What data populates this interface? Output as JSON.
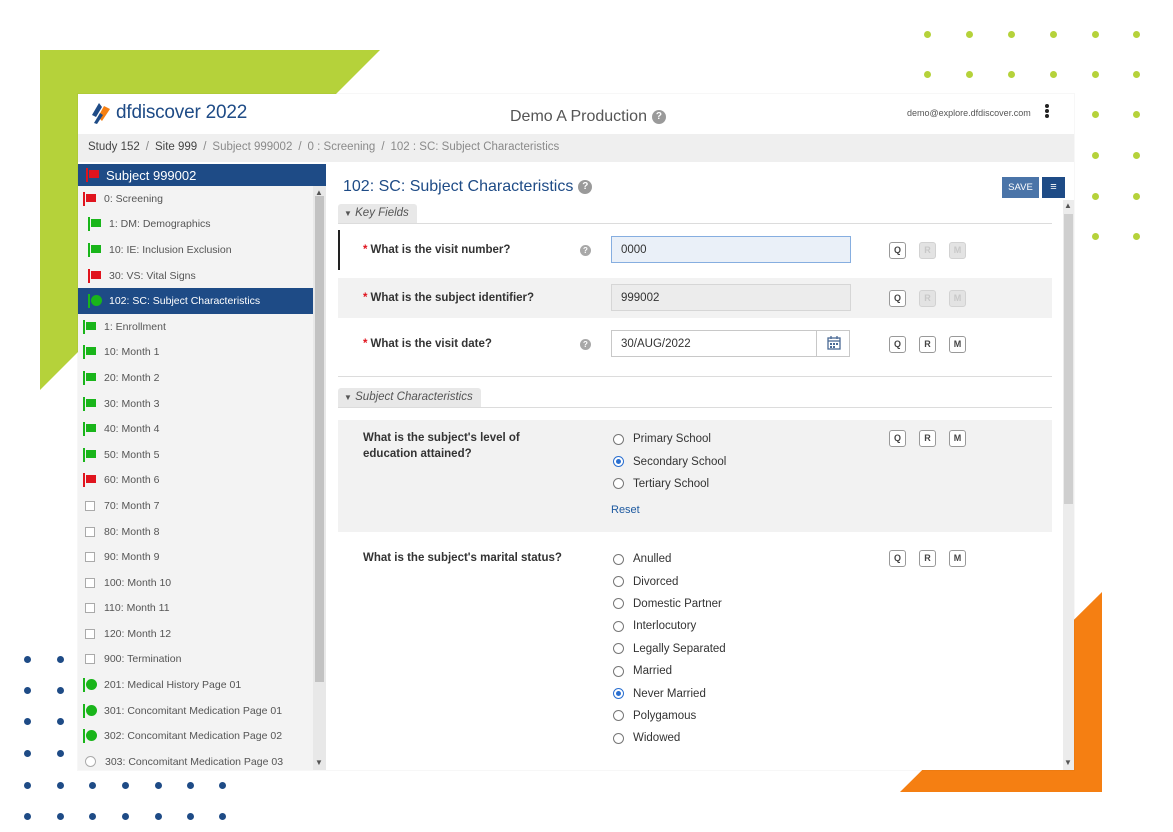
{
  "app": {
    "logo_text": "dfdiscover 2022",
    "title": "Demo A Production",
    "user_email": "demo@explore.dfdiscover.com"
  },
  "breadcrumb": [
    "Study 152",
    "Site 999",
    "Subject 999002",
    "0 : Screening",
    "102 : SC: Subject Characteristics"
  ],
  "sidebar": {
    "header": "Subject 999002",
    "items": [
      {
        "label": "0: Screening",
        "status": "red-flag"
      },
      {
        "label": "1: DM: Demographics",
        "status": "green-flag"
      },
      {
        "label": "10: IE: Inclusion Exclusion",
        "status": "green-flag"
      },
      {
        "label": "30: VS: Vital Signs",
        "status": "red-flag"
      },
      {
        "label": "102: SC: Subject Characteristics",
        "status": "green-circle"
      },
      {
        "label": "1: Enrollment",
        "status": "green-flag"
      },
      {
        "label": "10: Month 1",
        "status": "green-flag"
      },
      {
        "label": "20: Month 2",
        "status": "green-flag"
      },
      {
        "label": "30: Month 3",
        "status": "green-flag"
      },
      {
        "label": "40: Month 4",
        "status": "green-flag"
      },
      {
        "label": "50: Month 5",
        "status": "green-flag"
      },
      {
        "label": "60: Month 6",
        "status": "red-flag"
      },
      {
        "label": "70: Month 7",
        "status": "empty"
      },
      {
        "label": "80: Month 8",
        "status": "empty"
      },
      {
        "label": "90: Month 9",
        "status": "empty"
      },
      {
        "label": "100: Month 10",
        "status": "empty"
      },
      {
        "label": "110: Month 11",
        "status": "empty"
      },
      {
        "label": "120: Month 12",
        "status": "empty"
      },
      {
        "label": "900: Termination",
        "status": "empty"
      },
      {
        "label": "201: Medical History Page 01",
        "status": "green-circle"
      },
      {
        "label": "301: Concomitant Medication Page 01",
        "status": "green-circle"
      },
      {
        "label": "302: Concomitant Medication Page 02",
        "status": "green-circle"
      },
      {
        "label": "303: Concomitant Medication Page 03",
        "status": "empty-circle"
      }
    ]
  },
  "form": {
    "title": "102: SC: Subject Characteristics",
    "save_label": "SAVE",
    "sections": {
      "key_fields": "Key Fields",
      "subject_characteristics": "Subject Characteristics"
    },
    "visit_number": {
      "label": "What is the visit number?",
      "value": "0000"
    },
    "subject_id": {
      "label": "What is the subject identifier?",
      "value": "999002"
    },
    "visit_date": {
      "label": "What is the visit date?",
      "value": "30/AUG/2022"
    },
    "education": {
      "label": "What is the subject's level of education attained?",
      "options": [
        "Primary School",
        "Secondary School",
        "Tertiary School"
      ],
      "selected": "Secondary School",
      "reset_label": "Reset"
    },
    "marital": {
      "label": "What is the subject's marital status?",
      "options": [
        "Anulled",
        "Divorced",
        "Domestic Partner",
        "Interlocutory",
        "Legally Separated",
        "Married",
        "Never Married",
        "Polygamous",
        "Widowed"
      ],
      "selected": "Never Married"
    },
    "qrm": [
      "Q",
      "R",
      "M"
    ]
  },
  "colors": {
    "brand_blue": "#1e4b86",
    "accent_green": "#b5d23a",
    "accent_orange": "#f57f12",
    "flag_green": "#19b51a",
    "flag_red": "#e0141e"
  }
}
